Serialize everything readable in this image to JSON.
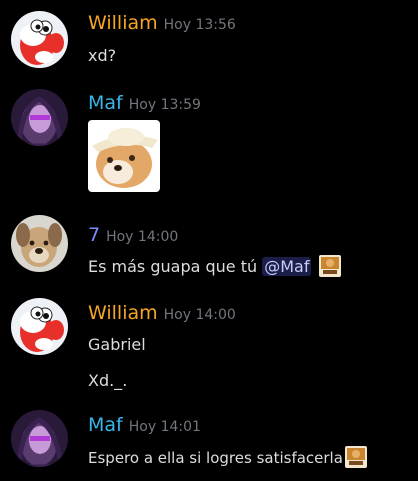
{
  "colors": {
    "background": "#000000",
    "william": "#f5a623",
    "maf": "#38b6e8",
    "seven": "#7d8cf6",
    "timestamp": "#72767d",
    "text": "#dcddde"
  },
  "messages": [
    {
      "author": "William",
      "time": "Hoy 13:56",
      "avatar_icon": "yoshi-avatar-icon",
      "lines": [
        "xd?"
      ]
    },
    {
      "author": "Maf",
      "time": "Hoy 13:59",
      "avatar_icon": "maf-avatar-icon",
      "attachment": "doge-cowboy-hat-image"
    },
    {
      "author": "7",
      "time": "Hoy 14:00",
      "avatar_icon": "dog-avatar-icon",
      "lines": [
        "Es más guapa que tú"
      ],
      "mention": "@Maf",
      "emoji": "custom-sticker-emoji"
    },
    {
      "author": "William",
      "time": "Hoy 14:00",
      "avatar_icon": "yoshi-avatar-icon",
      "lines": [
        "Gabriel",
        "Xd._."
      ]
    },
    {
      "author": "Maf",
      "time": "Hoy 14:01",
      "avatar_icon": "maf-avatar-icon",
      "lines": [
        "Espero a ella si logres satisfacerla"
      ],
      "emoji": "custom-sticker-emoji"
    }
  ]
}
